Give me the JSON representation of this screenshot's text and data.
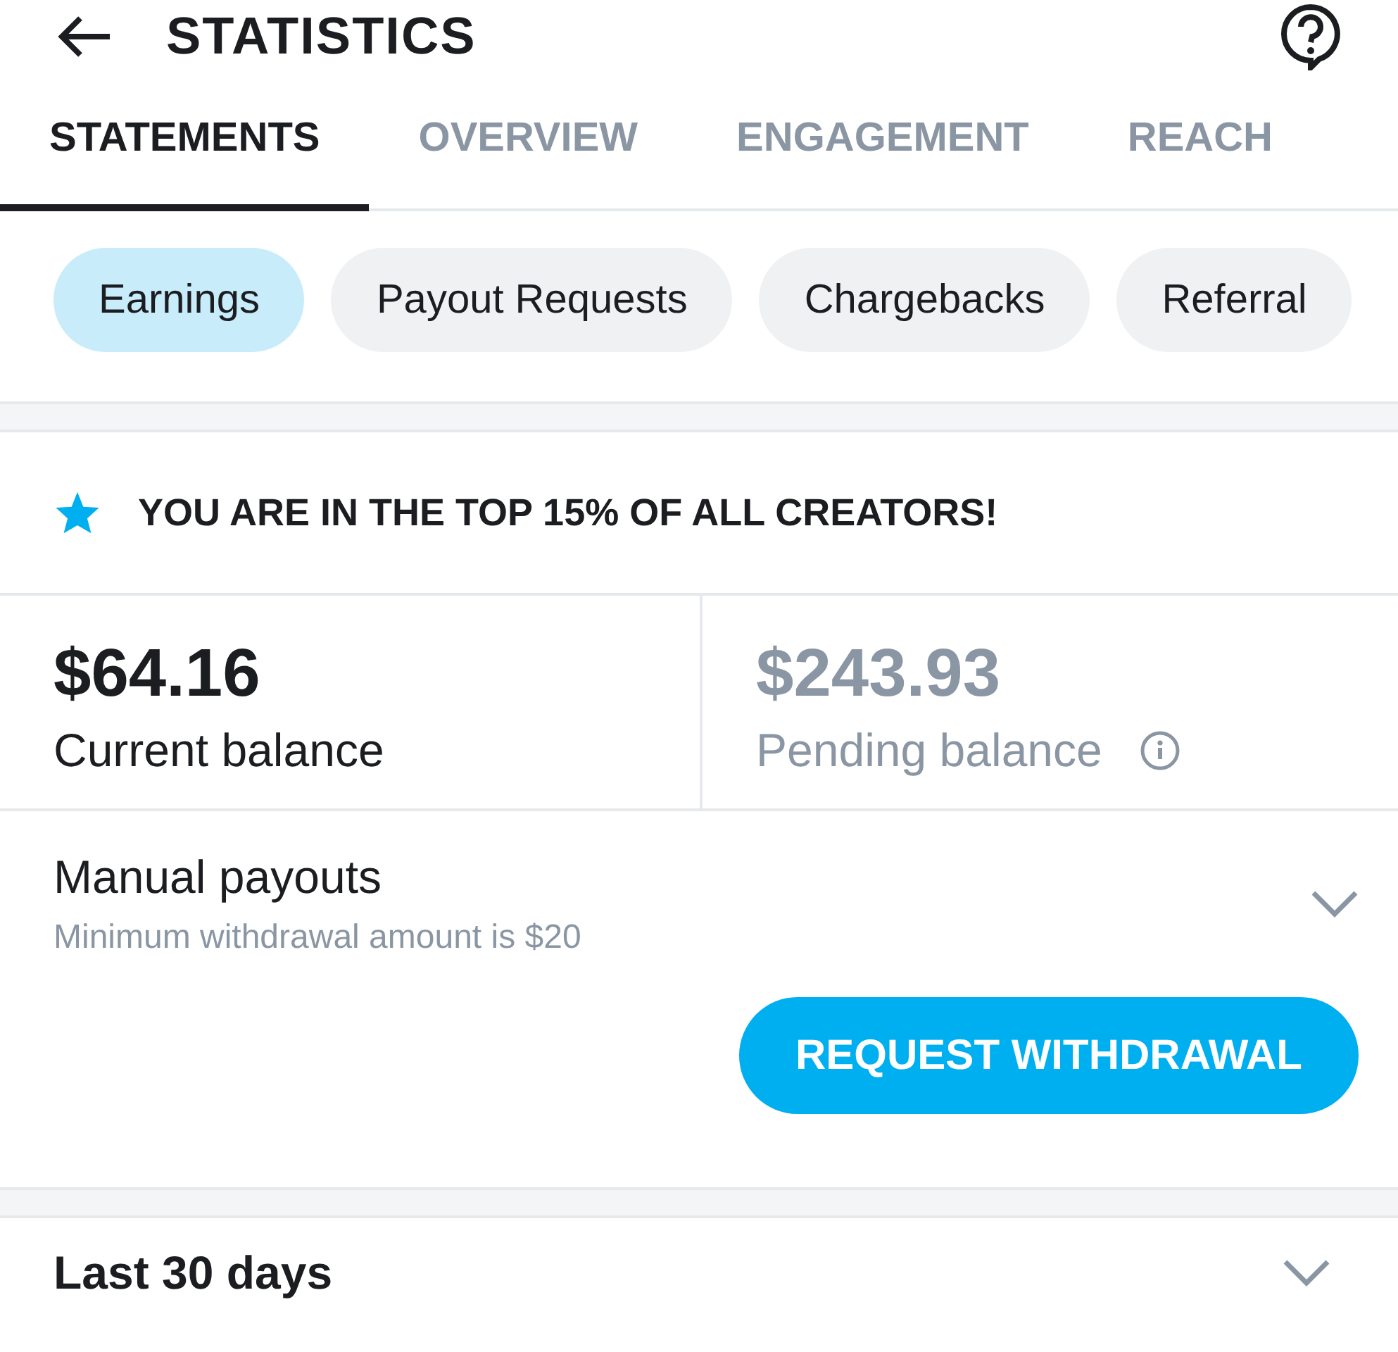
{
  "header": {
    "title": "STATISTICS"
  },
  "tabs": [
    {
      "label": "STATEMENTS",
      "selected": true
    },
    {
      "label": "OVERVIEW",
      "selected": false
    },
    {
      "label": "ENGAGEMENT",
      "selected": false
    },
    {
      "label": "REACH",
      "selected": false
    }
  ],
  "filters": [
    {
      "label": "Earnings",
      "selected": true
    },
    {
      "label": "Payout Requests",
      "selected": false
    },
    {
      "label": "Chargebacks",
      "selected": false
    },
    {
      "label": "Referral",
      "selected": false
    }
  ],
  "banner": {
    "text": "YOU ARE IN THE TOP 15% OF ALL CREATORS!"
  },
  "balances": [
    {
      "kind": "current",
      "amount": "$64.16",
      "label": "Current balance"
    },
    {
      "kind": "pending",
      "amount": "$243.93",
      "label": "Pending balance"
    }
  ],
  "payouts": {
    "title": "Manual payouts",
    "subtitle": "Minimum withdrawal amount is $20",
    "button": "REQUEST WITHDRAWAL"
  },
  "period": {
    "title": "Last 30 days"
  }
}
